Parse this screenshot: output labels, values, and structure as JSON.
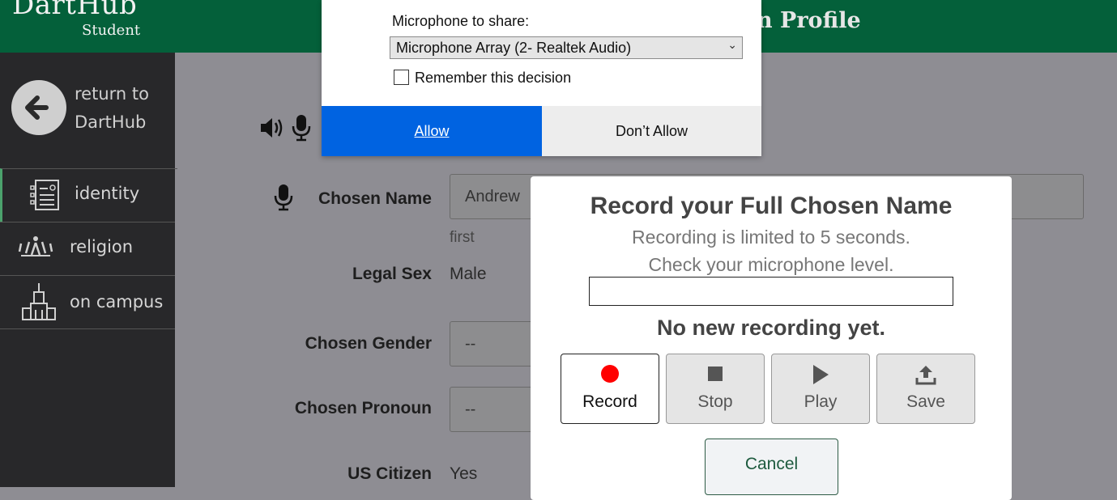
{
  "app": {
    "logo": "DartHub",
    "logo_sub": "Student",
    "page_title": "n Profile"
  },
  "sidebar": {
    "return_label": "return to DartHub",
    "items": [
      {
        "label": "identity",
        "icon": "id-card-icon"
      },
      {
        "label": "religion",
        "icon": "lotus-icon"
      },
      {
        "label": "on campus",
        "icon": "campus-building-icon"
      }
    ]
  },
  "form": {
    "chosen_name_label": "Chosen Name",
    "chosen_name_value": "Andrew",
    "chosen_name_hint": "first",
    "legal_sex_label": "Legal Sex",
    "legal_sex_value": "Male",
    "chosen_gender_label": "Chosen Gender",
    "chosen_gender_value": "--",
    "chosen_pronoun_label": "Chosen Pronoun",
    "chosen_pronoun_value": "--",
    "us_citizen_label": "US Citizen",
    "us_citizen_value": "Yes"
  },
  "permission_prompt": {
    "label": "Microphone to share:",
    "selected_device": "Microphone Array (2- Realtek Audio)",
    "remember_label": "Remember this decision",
    "remember_checked": false,
    "allow_label": "Allow",
    "deny_label": "Don’t Allow"
  },
  "record_dialog": {
    "title": "Record your Full Chosen Name",
    "subtitle_1": "Recording is limited to 5 seconds.",
    "subtitle_2": "Check your microphone level.",
    "status": "No new recording yet.",
    "buttons": [
      {
        "label": "Record",
        "icon": "record-dot-icon"
      },
      {
        "label": "Stop",
        "icon": "stop-square-icon"
      },
      {
        "label": "Play",
        "icon": "play-triangle-icon"
      },
      {
        "label": "Save",
        "icon": "upload-icon"
      }
    ],
    "cancel_label": "Cancel"
  },
  "colors": {
    "header_green": "#04603a",
    "sidebar_bg": "#28282a",
    "allow_blue": "#0063e1",
    "record_red": "#ff0000"
  }
}
